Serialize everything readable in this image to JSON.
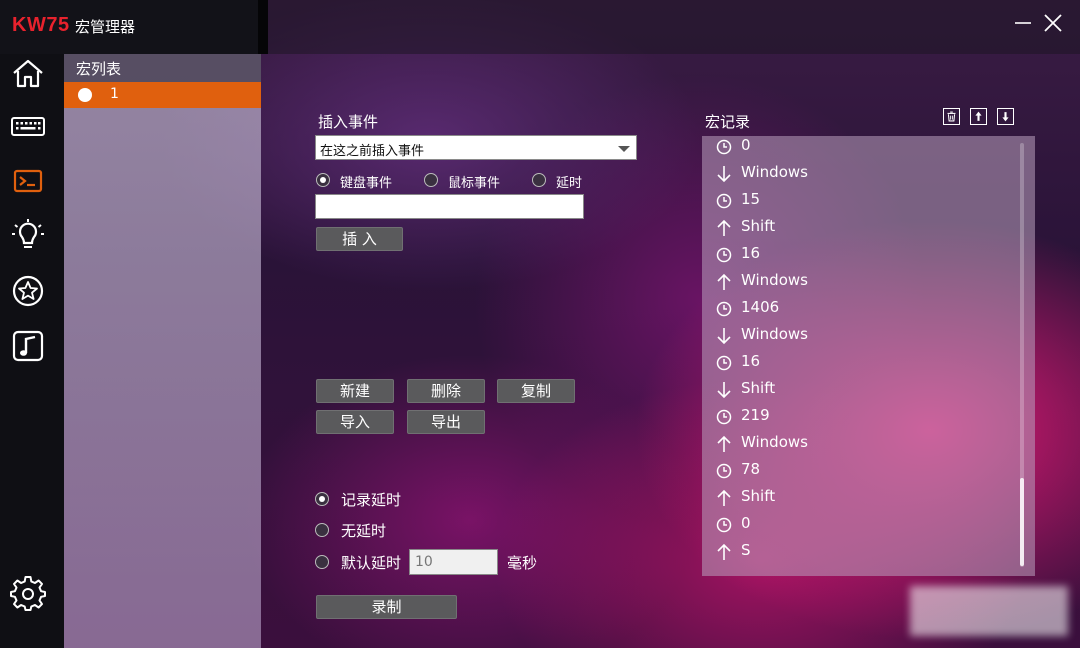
{
  "app": {
    "brand": "KW75",
    "title": "宏管理器"
  },
  "nav": {
    "items": [
      "home-icon",
      "keyboard-icon",
      "macro-terminal-icon",
      "lightbulb-icon",
      "star-icon",
      "music-icon",
      "gear-icon"
    ],
    "active": "macro-terminal-icon",
    "accent": "#e0600e"
  },
  "macro_list": {
    "title": "宏列表",
    "items": [
      {
        "label": "1",
        "selected": true
      }
    ]
  },
  "insert_event": {
    "title": "插入事件",
    "position_select": "在这之前插入事件",
    "types": [
      "键盘事件",
      "鼠标事件",
      "延时"
    ],
    "selected_type": "键盘事件",
    "input_value": "",
    "insert_label": "插 入"
  },
  "actions": {
    "new": "新建",
    "delete": "删除",
    "copy": "复制",
    "import": "导入",
    "export": "导出"
  },
  "delay": {
    "options": [
      "记录延时",
      "无延时",
      "默认延时"
    ],
    "selected": "记录延时",
    "default_value": "10",
    "unit": "毫秒",
    "record_label": "录制"
  },
  "record": {
    "title": "宏记录",
    "rows": [
      {
        "icon": "clock",
        "text": "0"
      },
      {
        "icon": "down",
        "text": "Windows"
      },
      {
        "icon": "clock",
        "text": "15"
      },
      {
        "icon": "up",
        "text": "Shift"
      },
      {
        "icon": "clock",
        "text": "16"
      },
      {
        "icon": "up",
        "text": "Windows"
      },
      {
        "icon": "clock",
        "text": "1406"
      },
      {
        "icon": "down",
        "text": "Windows"
      },
      {
        "icon": "clock",
        "text": "16"
      },
      {
        "icon": "down",
        "text": "Shift"
      },
      {
        "icon": "clock",
        "text": "219"
      },
      {
        "icon": "up",
        "text": "Windows"
      },
      {
        "icon": "clock",
        "text": "78"
      },
      {
        "icon": "up",
        "text": "Shift"
      },
      {
        "icon": "clock",
        "text": "0"
      },
      {
        "icon": "up",
        "text": "S"
      }
    ]
  }
}
